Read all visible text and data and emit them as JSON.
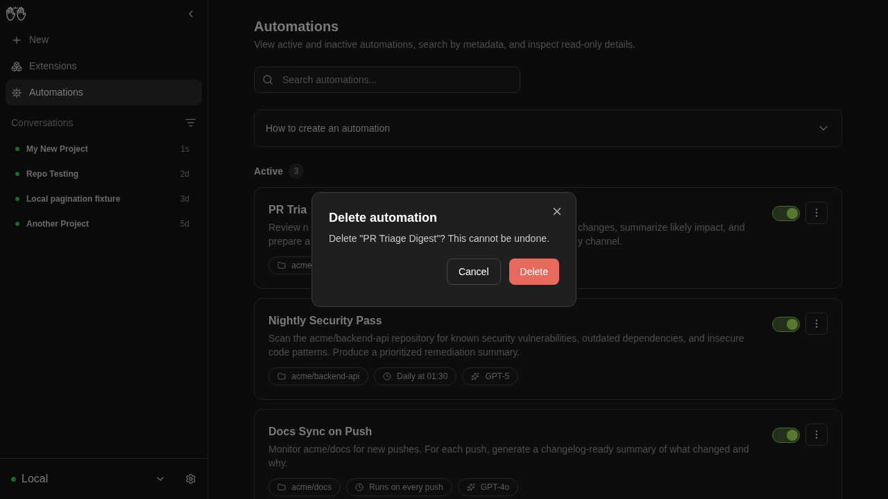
{
  "sidebar": {
    "items": [
      {
        "kind": "new",
        "label": "New",
        "selected": false
      },
      {
        "kind": "extensions",
        "label": "Extensions",
        "selected": false
      },
      {
        "kind": "automations",
        "label": "Automations",
        "selected": true
      }
    ],
    "conversations_heading": "Conversations",
    "conversations": [
      {
        "title": "My New Project",
        "time": "1s"
      },
      {
        "title": "Repo Testing",
        "time": "2d"
      },
      {
        "title": "Local pagination fixture",
        "time": "3d"
      },
      {
        "title": "Another Project",
        "time": "5d"
      }
    ],
    "footer": {
      "label": "Local"
    }
  },
  "header": {
    "title": "Automations",
    "subtitle": "View active and inactive automations, search by metadata, and inspect read-only details."
  },
  "search": {
    "placeholder": "Search automations..."
  },
  "help": {
    "label": "How to create an automation",
    "expanded": false
  },
  "section": {
    "label": "Active",
    "count": "3"
  },
  "automations": [
    {
      "kind": "covered",
      "title": "PR Tria",
      "lines": [
        {
          "left": "Review n",
          "right": "changes, summarize likely impact, and"
        },
        {
          "left": "prepare a",
          "right": "y channel."
        }
      ],
      "tags": [
        {
          "kind": "repo",
          "label": "acme"
        }
      ],
      "on": true
    },
    {
      "kind": "full",
      "title": "Nightly Security Pass",
      "description": "Scan the acme/backend-api repository for known security vulnerabilities, outdated dependencies, and insecure code patterns. Produce a prioritized remediation summary.",
      "tags": [
        {
          "kind": "repo",
          "label": "acme/backend-api"
        },
        {
          "kind": "schedule",
          "label": "Daily at 01:30"
        },
        {
          "kind": "model",
          "label": "GPT-5"
        }
      ],
      "on": true
    },
    {
      "kind": "full",
      "title": "Docs Sync on Push",
      "description": "Monitor acme/docs for new pushes. For each push, generate a changelog-ready summary of what changed and why.",
      "tags": [
        {
          "kind": "repo",
          "label": "acme/docs"
        },
        {
          "kind": "schedule",
          "label": "Runs on every push"
        },
        {
          "kind": "model",
          "label": "GPT-4o"
        }
      ],
      "on": true
    }
  ],
  "dialog": {
    "title": "Delete automation",
    "message": "Delete \"PR Triage Digest\"? This cannot be undone.",
    "cancel": "Cancel",
    "confirm": "Delete"
  }
}
